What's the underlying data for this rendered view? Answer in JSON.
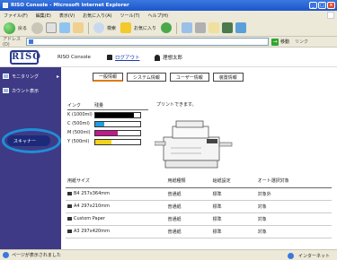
{
  "window": {
    "title": "RISO Console - Microsoft Internet Explorer"
  },
  "menu": [
    "ファイル(F)",
    "編集(E)",
    "表示(V)",
    "お気に入り(A)",
    "ツール(T)",
    "ヘルプ(H)"
  ],
  "toolbar": {
    "back": "戻る",
    "search": "検索",
    "favorites": "お気に入り"
  },
  "address": {
    "label": "アドレス(D)",
    "go": "移動",
    "links": "リンク"
  },
  "header": {
    "logo": "RISO",
    "console_name": "RISO Console",
    "logout": "ログアウト",
    "admin": "管理者",
    "user_label": "理想太郎"
  },
  "sidebar": {
    "items": [
      {
        "label": "モニタリング"
      },
      {
        "label": "カウント表示"
      },
      {
        "label": "スキャナー"
      }
    ]
  },
  "tabs": [
    "一般情報",
    "システム情報",
    "ユーザー情報",
    "装置情報"
  ],
  "ink": {
    "header_ink": "インク",
    "header_level": "残量",
    "rows": [
      {
        "label": "K (1000ml)",
        "level": 0.85,
        "color": "#000000"
      },
      {
        "label": "C (500ml)",
        "level": 0.2,
        "color": "#1e9fe0"
      },
      {
        "label": "M (500ml)",
        "level": 0.5,
        "color": "#c2188c"
      },
      {
        "label": "Y (500ml)",
        "level": 0.35,
        "color": "#f2d21a"
      }
    ]
  },
  "status_message": "プリントできます。",
  "trays": {
    "headers": [
      "用紙サイズ",
      "用紙種類",
      "給紙設定",
      "オート選択対象"
    ],
    "rows": [
      {
        "icon": "tray-icon",
        "size": "B4 257x364mm",
        "type": "普通紙",
        "feed": "標準",
        "auto": "対象外"
      },
      {
        "icon": "tray-icon",
        "size": "A4 297x210mm",
        "type": "普通紙",
        "feed": "標準",
        "auto": "対象"
      },
      {
        "icon": "tray-icon",
        "size": "Custom Paper",
        "type": "普通紙",
        "feed": "標準",
        "auto": "対象"
      },
      {
        "icon": "tray-icon",
        "size": "A3 297x420mm",
        "type": "普通紙",
        "feed": "標準",
        "auto": "対象"
      }
    ]
  },
  "statusbar": {
    "text": "ページが表示されました",
    "zone": "インターネット"
  }
}
